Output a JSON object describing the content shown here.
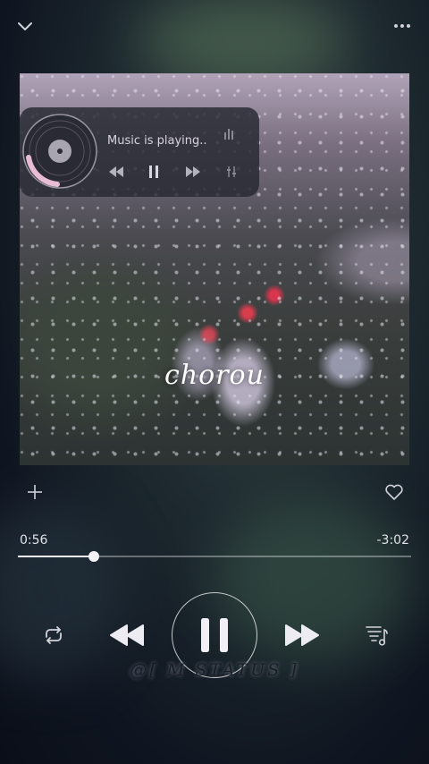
{
  "header": {
    "collapse_icon": "chevron-down-icon",
    "more_icon": "ellipsis-icon"
  },
  "mini_widget": {
    "status_text": "Music is playing..",
    "icons": [
      "vinyl-record-icon",
      "equalizer-bars-icon",
      "rewind-icon",
      "pause-icon",
      "fast-forward-icon",
      "equalizer-small-icon"
    ]
  },
  "track": {
    "title": "chorou"
  },
  "actions": {
    "add_icon": "plus-icon",
    "favorite_icon": "heart-icon"
  },
  "progress": {
    "elapsed": "0:56",
    "remaining": "-3:02",
    "fraction": 0.194
  },
  "controls": [
    "repeat-icon",
    "rewind-icon",
    "pause-icon",
    "fast-forward-icon",
    "queue-icon"
  ],
  "watermark": "@[ M STATUS ]",
  "colors": {
    "accent": "#f2f2f6",
    "widget_bg": "#26283299",
    "background": "#1e2a30"
  }
}
